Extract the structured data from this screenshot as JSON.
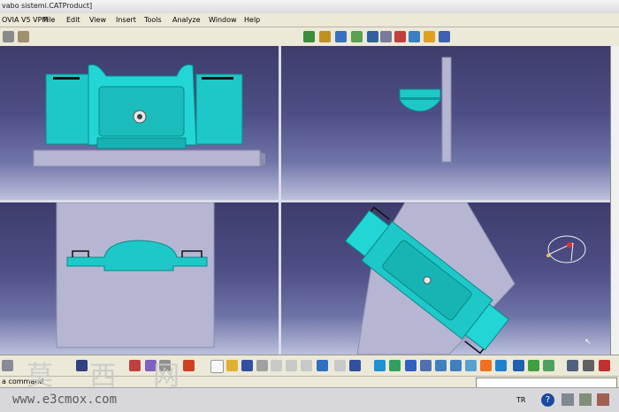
{
  "window": {
    "title": "vabo sistemi.CATProduct]"
  },
  "menubar": {
    "app_label": "OVIA V5 VPM",
    "items": [
      "File",
      "Edit",
      "View",
      "Insert",
      "Tools",
      "Analyze",
      "Window",
      "Help"
    ]
  },
  "commandbar": {
    "label": "a command"
  },
  "statusbar": {
    "language": "TR"
  },
  "watermark": {
    "chars": "莫 西 网",
    "site": "www.e3cmox.com"
  },
  "icons": {
    "top_toolbar": [
      "sketch-icon",
      "part-icon",
      "surface-icon",
      "analysis-icon",
      "measure-icon",
      "knowledge-icon",
      "tree-icon",
      "params-icon",
      "rotate-icon",
      "grid-icon"
    ],
    "bottom_toolbar": [
      "new-icon",
      "open-icon",
      "save-icon",
      "print-icon",
      "cut-icon",
      "copy-icon",
      "paste-icon",
      "undo-icon",
      "redo-icon",
      "help-icon",
      "fly-icon",
      "fit-all-icon",
      "pan-icon",
      "rotate-view-icon",
      "zoom-in-icon",
      "zoom-out-icon",
      "normal-view-icon",
      "iso-view-icon",
      "view-mode-icon",
      "shading-icon",
      "hide-show-icon",
      "swap-icon"
    ]
  },
  "colors": {
    "part": "#1ec8c8",
    "background_top": "#3e3c6c",
    "background_bottom": "#bcc1dc"
  }
}
